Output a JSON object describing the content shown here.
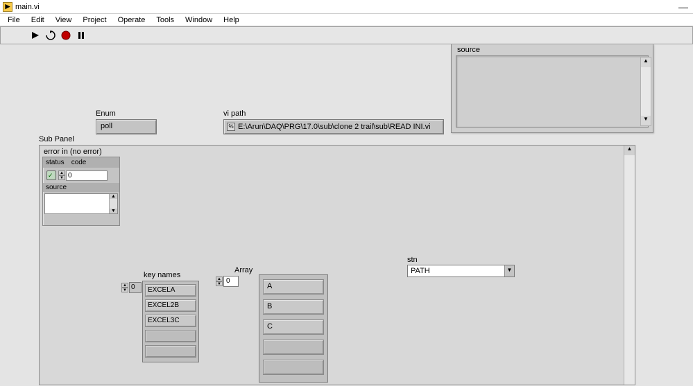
{
  "window": {
    "title": "main.vi",
    "minimize_glyph": "—"
  },
  "menu": {
    "file": "File",
    "edit": "Edit",
    "view": "View",
    "project": "Project",
    "operate": "Operate",
    "tools": "Tools",
    "window": "Window",
    "help": "Help"
  },
  "toolbar_icons": {
    "run": "arrow-right",
    "run_cont": "cyclic-arrows",
    "abort": "red-circle",
    "pause": "pause-bars"
  },
  "source_panel": {
    "label": "source",
    "value": ""
  },
  "enum": {
    "label": "Enum",
    "value": "poll"
  },
  "vi_path": {
    "label": "vi path",
    "value": "E:\\Arun\\DAQ\\PRG\\17.0\\sub\\clone 2 trail\\sub\\READ INI.vi"
  },
  "subpanel": {
    "label": "Sub Panel"
  },
  "error_in": {
    "label": "error in (no error)",
    "status_label": "status",
    "code_label": "code",
    "code_value": "0",
    "status_ok_glyph": "✓",
    "source_label": "source",
    "source_value": ""
  },
  "key_names": {
    "label": "key names",
    "index": "0",
    "items": [
      "EXCELA",
      "EXCEL2B",
      "EXCEL3C",
      "",
      ""
    ]
  },
  "array": {
    "label": "Array",
    "index": "0",
    "items": [
      "A",
      "B",
      "C",
      "",
      ""
    ]
  },
  "stn": {
    "label": "stn",
    "value": "PATH"
  }
}
